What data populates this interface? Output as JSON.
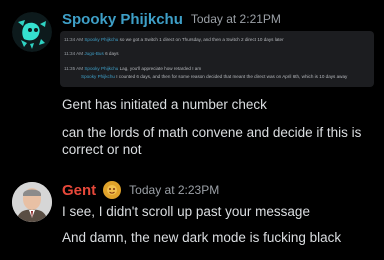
{
  "messages": [
    {
      "username": "Spooky Phijkchu",
      "timestamp": "Today at 2:21PM",
      "embedded_messages": [
        {
          "prefix": "11:34 AM",
          "author": "Spooky Phijkchu",
          "text": "so we got a Switch 1 direct on Thursday, and then a Switch 2 direct 10 days later"
        },
        {
          "prefix": "11:34 AM",
          "author": "Jugo-Bus",
          "text": "6 days"
        },
        {
          "prefix": "11:35 AM",
          "author": "Spooky Phijkchu",
          "text": "Lag, you'll appreciate how retarded I am"
        },
        {
          "prefix": "",
          "author": "Spooky Phijkchu",
          "text": "I counted 6 days, and then for some reason decided that meant the direct was on April 6th, which is 10 days away"
        }
      ],
      "lines": [
        "Gent has initiated a number check",
        "can the lords of math convene and decide if this is correct or not"
      ]
    },
    {
      "username": "Gent",
      "timestamp": "Today at 2:23PM",
      "lines": [
        "I see, I didn't scroll up past your message",
        "And damn, the new dark mode is fucking black"
      ]
    }
  ],
  "colors": {
    "background": "#000000",
    "username_1": "#3e9fc7",
    "username_2": "#e6483a",
    "text": "#dbdee1",
    "timestamp": "#9ba0a6"
  },
  "icons": {
    "avatar_1": "spooky-ghost-avatar",
    "avatar_2": "gent-portrait-avatar",
    "role_badge": "role-badge-icon"
  }
}
